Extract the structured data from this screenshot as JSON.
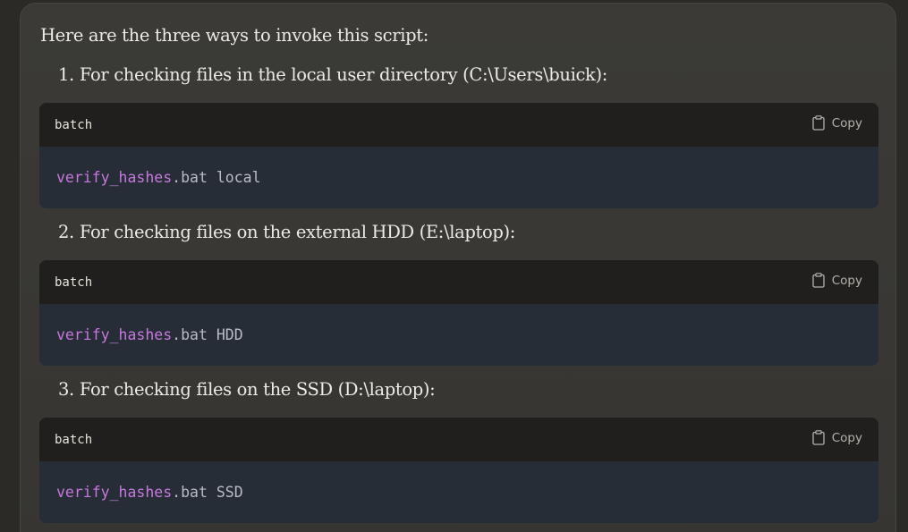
{
  "intro": "Here are the three ways to invoke this script:",
  "steps": [
    {
      "number": "1.",
      "text": "For checking files in the local user directory (C:\\Users\\buick):",
      "code": {
        "lang": "batch",
        "copy_label": "Copy",
        "command": "verify_hashes",
        "ext": ".bat",
        "arg": "local"
      }
    },
    {
      "number": "2.",
      "text": "For checking files on the external HDD (E:\\laptop):",
      "code": {
        "lang": "batch",
        "copy_label": "Copy",
        "command": "verify_hashes",
        "ext": ".bat",
        "arg": "HDD"
      }
    },
    {
      "number": "3.",
      "text": "For checking files on the SSD (D:\\laptop):",
      "code": {
        "lang": "batch",
        "copy_label": "Copy",
        "command": "verify_hashes",
        "ext": ".bat",
        "arg": "SSD"
      }
    }
  ],
  "icons": {
    "copy": "clipboard-icon"
  },
  "colors": {
    "page_bg": "#2b2a27",
    "card_bg": "#3a3935",
    "code_header_bg": "#201f1d",
    "code_body_bg": "#262d37",
    "command_color": "#c678dd",
    "text_color": "#ecebe6"
  }
}
